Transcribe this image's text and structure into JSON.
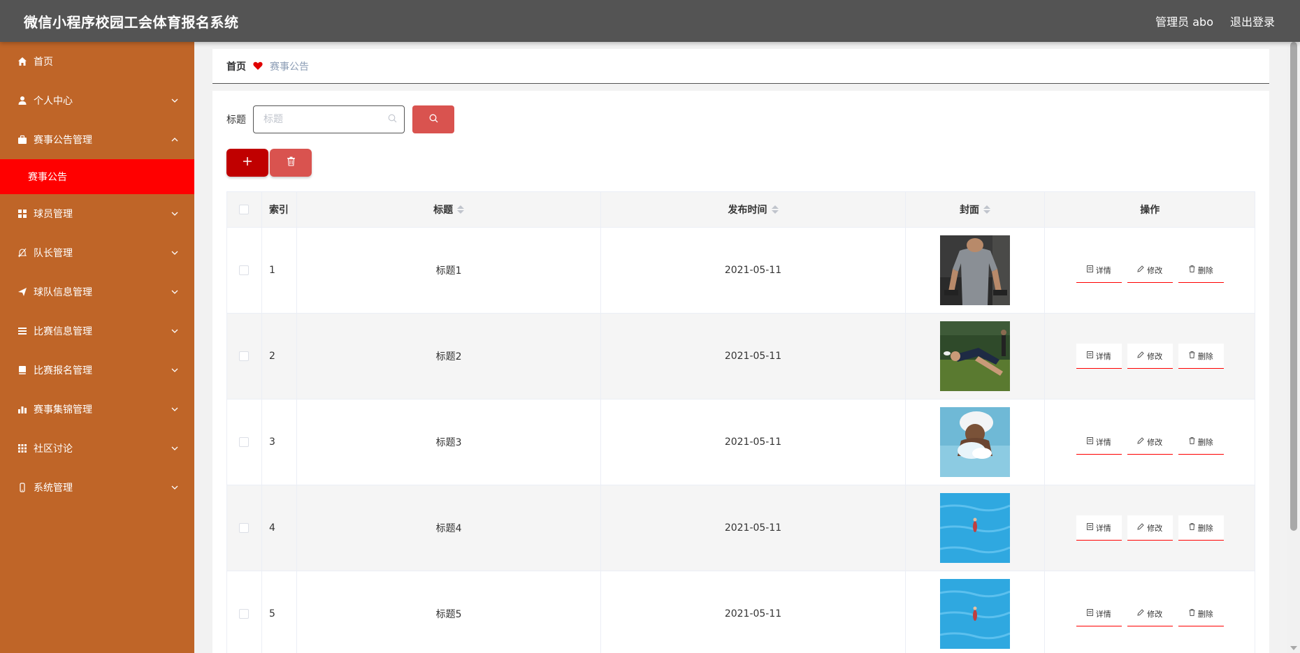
{
  "header": {
    "title": "微信小程序校园工会体育报名系统",
    "user": "管理员 abo",
    "logout": "退出登录"
  },
  "sidebar": {
    "items": [
      {
        "label": "首页",
        "icon": "home-icon",
        "chevron": false
      },
      {
        "label": "个人中心",
        "icon": "user-icon",
        "chevron": "down"
      },
      {
        "label": "赛事公告管理",
        "icon": "briefcase-icon",
        "chevron": "up"
      },
      {
        "label": "球员管理",
        "icon": "grid-icon",
        "chevron": "down"
      },
      {
        "label": "队长管理",
        "icon": "bell-off-icon",
        "chevron": "down"
      },
      {
        "label": "球队信息管理",
        "icon": "send-icon",
        "chevron": "down"
      },
      {
        "label": "比赛信息管理",
        "icon": "list-icon",
        "chevron": "down"
      },
      {
        "label": "比赛报名管理",
        "icon": "notebook-icon",
        "chevron": "down"
      },
      {
        "label": "赛事集锦管理",
        "icon": "bar-chart-icon",
        "chevron": "down"
      },
      {
        "label": "社区讨论",
        "icon": "apps-icon",
        "chevron": "down"
      },
      {
        "label": "系统管理",
        "icon": "phone-icon",
        "chevron": "down"
      }
    ],
    "active_sub": "赛事公告"
  },
  "breadcrumb": {
    "home": "首页",
    "current": "赛事公告"
  },
  "search": {
    "label": "标题",
    "placeholder": "标题"
  },
  "table": {
    "headers": {
      "index": "索引",
      "title": "标题",
      "time": "发布时间",
      "cover": "封面",
      "ops": "操作"
    },
    "rows": [
      {
        "index": "1",
        "title": "标题1",
        "time": "2021-05-11"
      },
      {
        "index": "2",
        "title": "标题2",
        "time": "2021-05-11"
      },
      {
        "index": "3",
        "title": "标题3",
        "time": "2021-05-11"
      },
      {
        "index": "4",
        "title": "标题4",
        "time": "2021-05-11"
      },
      {
        "index": "5",
        "title": "标题5",
        "time": "2021-05-11"
      }
    ],
    "op_labels": {
      "detail": "详情",
      "edit": "修改",
      "delete": "删除"
    }
  },
  "colors": {
    "header": "#545454",
    "sidebar": "#bf6528",
    "active": "#ff0000",
    "primary": "#d9534f",
    "add": "#c00000"
  }
}
